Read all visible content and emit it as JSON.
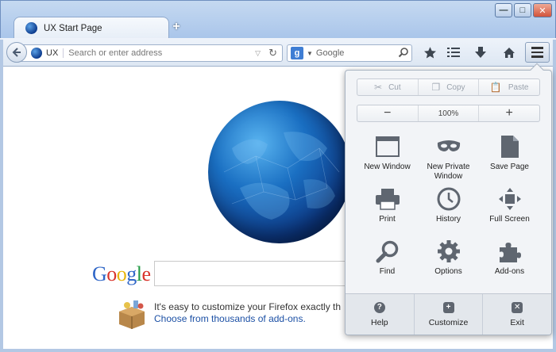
{
  "window": {
    "minimize": "—",
    "maximize": "□",
    "close": "✕"
  },
  "tab": {
    "title": "UX Start Page",
    "new_tab": "+"
  },
  "navbar": {
    "site_label": "UX",
    "url_placeholder": "Search or enter address",
    "search_engine": "g",
    "search_placeholder": "Google"
  },
  "content": {
    "google_logo": [
      "G",
      "o",
      "o",
      "g",
      "l",
      "e"
    ],
    "promo_line1": "It's easy to customize your Firefox exactly th",
    "promo_line2": "Choose from thousands of add-ons."
  },
  "menu": {
    "edit": {
      "cut": "Cut",
      "copy": "Copy",
      "paste": "Paste"
    },
    "zoom": {
      "minus": "−",
      "value": "100%",
      "plus": "+"
    },
    "items": [
      {
        "label": "New Window",
        "icon": "new-window-icon"
      },
      {
        "label": "New Private\nWindow",
        "icon": "private-mask-icon"
      },
      {
        "label": "Save Page",
        "icon": "save-page-icon"
      },
      {
        "label": "Print",
        "icon": "printer-icon"
      },
      {
        "label": "History",
        "icon": "history-clock-icon"
      },
      {
        "label": "Full Screen",
        "icon": "full-screen-icon"
      },
      {
        "label": "Find",
        "icon": "magnifier-icon"
      },
      {
        "label": "Options",
        "icon": "gear-icon"
      },
      {
        "label": "Add-ons",
        "icon": "puzzle-icon"
      }
    ],
    "footer": {
      "help": "Help",
      "customize": "Customize",
      "exit": "Exit"
    }
  }
}
